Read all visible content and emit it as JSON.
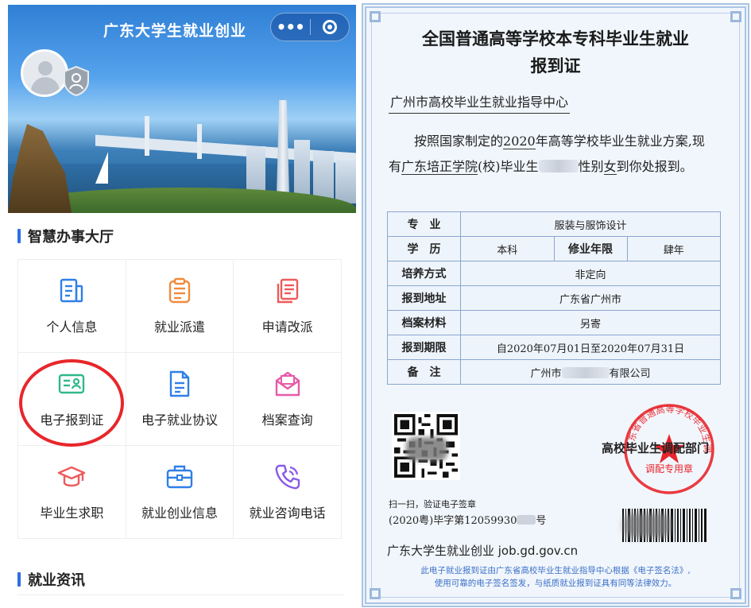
{
  "app": {
    "title": "广东大学生就业创业",
    "capsule_more": "•••"
  },
  "sections": {
    "service_hall": "智慧办事大厅",
    "news": "就业资讯"
  },
  "services": [
    {
      "label": "个人信息",
      "icon": "doc-list-icon",
      "color": "#2f7fe8"
    },
    {
      "label": "就业派遣",
      "icon": "clipboard-icon",
      "color": "#f08a3a"
    },
    {
      "label": "申请改派",
      "icon": "copy-doc-icon",
      "color": "#ee5a5a"
    },
    {
      "label": "电子报到证",
      "icon": "id-card-icon",
      "color": "#2fb88a"
    },
    {
      "label": "电子就业协议",
      "icon": "contract-icon",
      "color": "#2f7fe8"
    },
    {
      "label": "档案查询",
      "icon": "envelope-icon",
      "color": "#e85aa8"
    },
    {
      "label": "毕业生求职",
      "icon": "graduation-cap-icon",
      "color": "#ee5a5a"
    },
    {
      "label": "就业创业信息",
      "icon": "briefcase-icon",
      "color": "#2f7fe8"
    },
    {
      "label": "就业咨询电话",
      "icon": "phone-icon",
      "color": "#8a5ae8"
    }
  ],
  "certificate": {
    "title_line1": "全国普通高等学校本专科毕业生就业",
    "title_line2": "报到证",
    "addressee": "广州市高校毕业生就业指导中心",
    "para_a": "按照国家制定的",
    "para_year": "2020",
    "para_b": "年高等学校毕业生就业方案,现",
    "para_c": "有",
    "para_school": "广东培正学院",
    "para_d": "(校)毕业生",
    "para_e": "性别",
    "para_gender": "女",
    "para_f": "到你处报到。",
    "rows": {
      "major_label": "专　业",
      "major_value": "服装与服饰设计",
      "degree_label": "学　历",
      "degree_value": "本科",
      "years_label": "修业年限",
      "years_value": "肆年",
      "training_label": "培养方式",
      "training_value": "非定向",
      "address_label": "报到地址",
      "address_value": "广东省广州市",
      "archive_label": "档案材料",
      "archive_value": "另寄",
      "period_label": "报到期限",
      "period_value": "自2020年07月01日至2020年07月31日",
      "remark_label": "备　注",
      "remark_value_a": "广州市",
      "remark_value_b": "有限公司"
    },
    "issuer": "高校毕业生调配部门",
    "seal_text": "广东省普通高等学校毕业生调配专用章",
    "seal_bottom": "调配专用章",
    "scan_text": "扫一扫，验证电子签章",
    "reg_a": "(2020粤)毕字第12059930",
    "reg_b": "号",
    "site": "广东大学生就业创业  job.gd.gov.cn",
    "footer_line1": "此电子就业报到证由广东省高校毕业生就业指导中心根据《电子签名法》,",
    "footer_line2": "使用可靠的电子签名签发，与纸质就业报到证具有同等法律效力。"
  }
}
